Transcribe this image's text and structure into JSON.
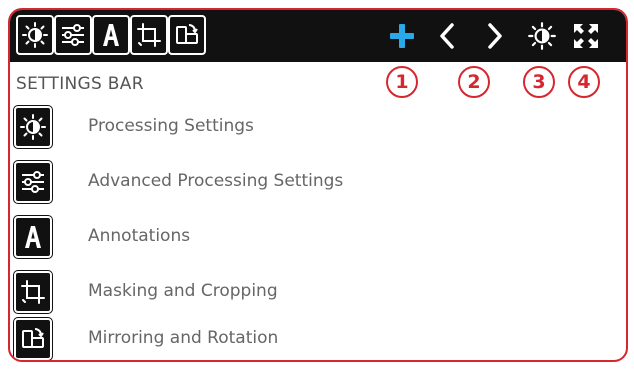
{
  "toolbar": {
    "left_buttons": [
      {
        "icon": "brightness-icon",
        "name": "Processing Settings"
      },
      {
        "icon": "sliders-icon",
        "name": "Advanced Processing Settings"
      },
      {
        "icon": "annotation-a-icon",
        "name": "Annotations"
      },
      {
        "icon": "crop-icon",
        "name": "Masking and Cropping"
      },
      {
        "icon": "mirror-rotate-icon",
        "name": "Mirroring and Rotation"
      }
    ],
    "right_buttons": [
      {
        "icon": "plus-icon",
        "color": "#2aa8e8"
      },
      {
        "icon": "chevron-left-icon"
      },
      {
        "icon": "chevron-right-icon"
      },
      {
        "icon": "brightness-icon"
      },
      {
        "icon": "expand-icon"
      }
    ]
  },
  "callouts": [
    "1",
    "2",
    "3",
    "4"
  ],
  "section": {
    "title": "SETTINGS BAR"
  },
  "items": [
    {
      "icon": "brightness-icon",
      "label": "Processing Settings"
    },
    {
      "icon": "sliders-icon",
      "label": "Advanced Processing Settings"
    },
    {
      "icon": "annotation-a-icon",
      "label": "Annotations"
    },
    {
      "icon": "crop-icon",
      "label": "Masking and Cropping"
    },
    {
      "icon": "mirror-rotate-icon",
      "label": "Mirroring and Rotation"
    }
  ],
  "colors": {
    "accent": "#d6272f",
    "toolbar_bg": "#111111",
    "plus": "#2aa8e8",
    "text": "#666666"
  }
}
